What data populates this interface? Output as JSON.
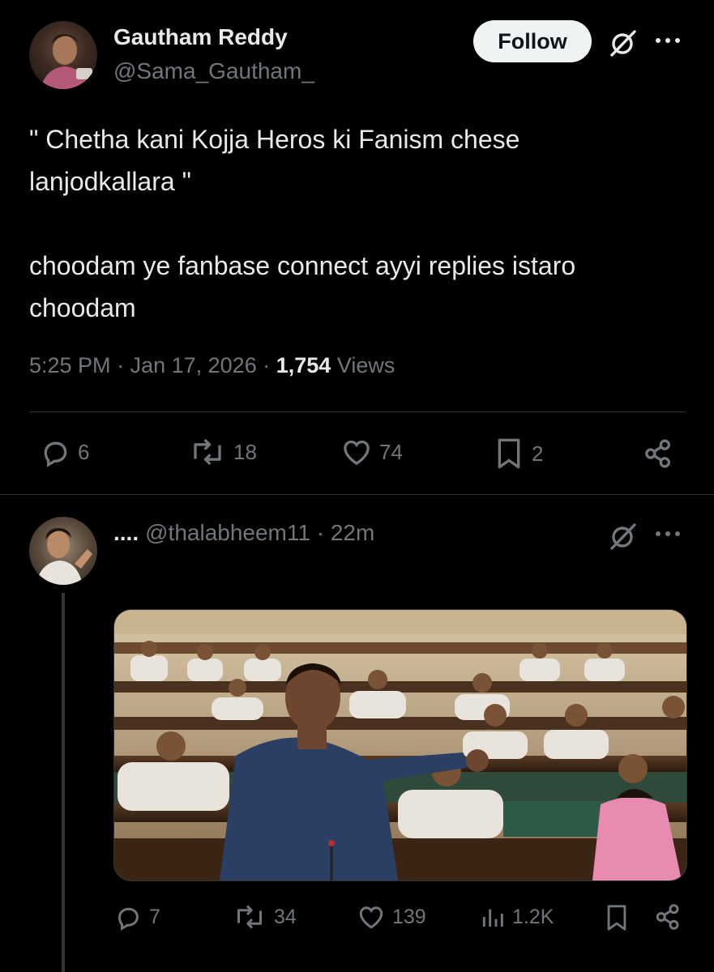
{
  "tweet": {
    "author_name": "Gautham Reddy",
    "author_handle": "@Sama_Gautham_",
    "follow_label": "Follow",
    "text": "\" Chetha kani Kojja Heros ki Fanism chese\nlanjodkallara \"\n\nchoodam ye fanbase connect ayyi replies istaro\nchoodam",
    "time": "5:25 PM",
    "date": "Jan 17, 2026",
    "views_count": "1,754",
    "views_label": "Views",
    "stats": {
      "replies": "6",
      "reposts": "18",
      "likes": "74",
      "bookmarks": "2"
    },
    "icons": [
      "grok-icon",
      "more-icon",
      "reply-icon",
      "repost-icon",
      "like-icon",
      "bookmark-icon",
      "share-icon"
    ]
  },
  "reply": {
    "author_name": "....",
    "author_handle": "@thalabheem11",
    "time_ago": "22m",
    "stats": {
      "replies": "7",
      "reposts": "34",
      "likes": "139",
      "views": "1.2K"
    },
    "icons": [
      "grok-icon",
      "more-icon",
      "reply-icon",
      "repost-icon",
      "like-icon",
      "views-icon",
      "bookmark-icon",
      "share-icon"
    ]
  },
  "colors": {
    "background": "#000000",
    "text_primary": "#e7e9ea",
    "text_secondary": "#71767b",
    "divider": "#2f3336",
    "follow_bg": "#eff3f4"
  }
}
